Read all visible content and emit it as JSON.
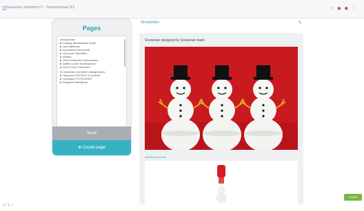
{
  "browser": {
    "url": "hexaware.tietoperm.fi › Teamsmatsat (Fi)"
  },
  "sidebar": {
    "title": "Pages",
    "groups": [
      {
        "label": "Introduzione",
        "items": [
          "Casting Identification Scale",
          "Jest Materials",
          "Importanti Documentti",
          "Outcome Planetteis",
          "Wuban",
          "Outer Extended Optimization",
          "Dotted Curve Sustanancen",
          "Grow Color Cellsocies"
        ]
      },
      {
        "label": "Te clasoiazo 4ea hafre ralangrunioes",
        "items": [
          "Ohjaavia 7GOTELY 5 Konteen",
          "Lakeijoja 2 OTNYUISET",
          "Kauppan Raelaisupi"
        ]
      }
    ],
    "button_gray": "Sinulle",
    "button_teal": "⊕ Create page"
  },
  "main": {
    "title": "Snowmen",
    "caption": "Snowmen designed by Snowmen team",
    "thumb_link": "Add files for more"
  },
  "footer": {
    "page_num": "1 / 1 —",
    "badge": "Create"
  }
}
